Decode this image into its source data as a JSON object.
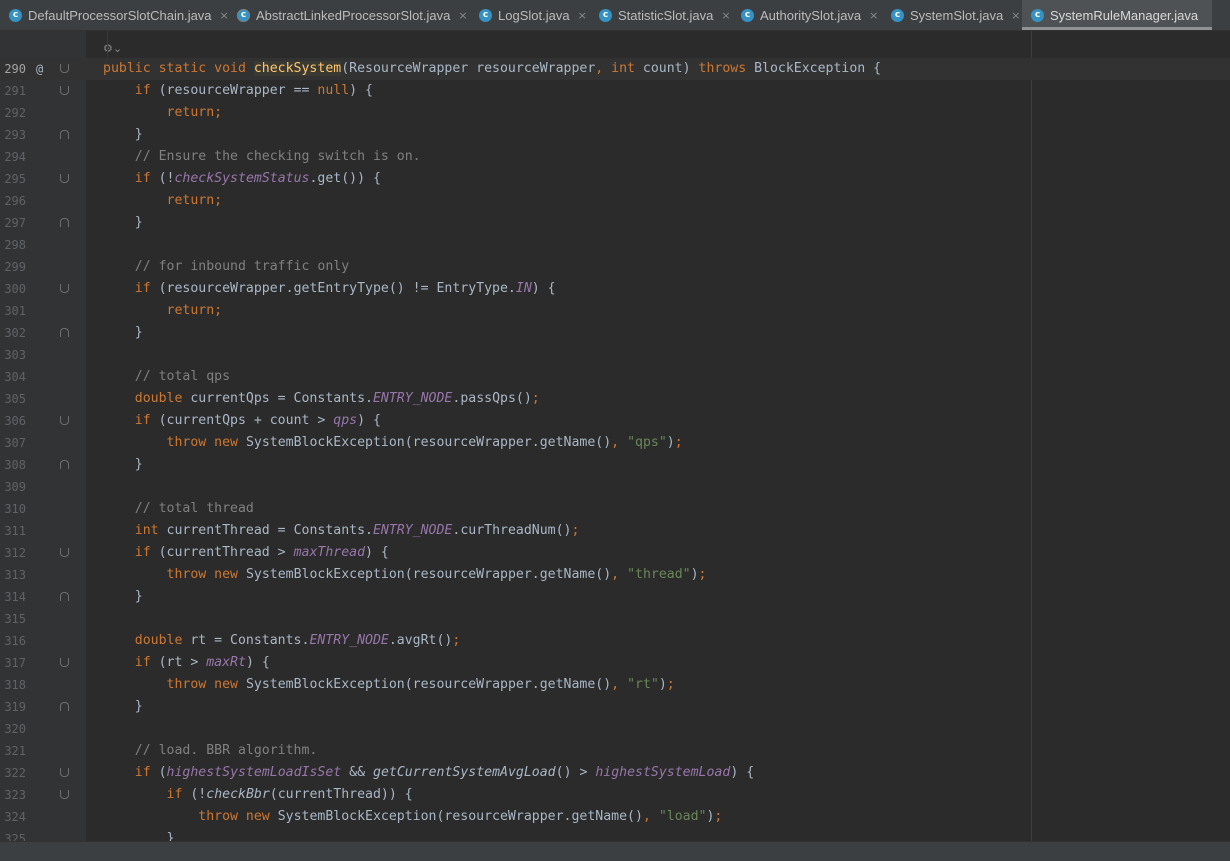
{
  "tabs": [
    {
      "label": "DefaultProcessorSlotChain.java",
      "icon": "class-icon",
      "close": "×"
    },
    {
      "label": "AbstractLinkedProcessorSlot.java",
      "icon": "abstract-class-icon",
      "close": "×"
    },
    {
      "label": "LogSlot.java",
      "icon": "class-icon",
      "close": "×"
    },
    {
      "label": "StatisticSlot.java",
      "icon": "class-icon",
      "close": "×"
    },
    {
      "label": "AuthoritySlot.java",
      "icon": "class-icon",
      "close": "×"
    },
    {
      "label": "SystemSlot.java",
      "icon": "class-icon",
      "close": "×"
    },
    {
      "label": "SystemRuleManager.java",
      "icon": "class-icon",
      "close": ""
    }
  ],
  "tab_icon_letter": "c",
  "editor": {
    "gutter_marker": "@",
    "annotation_icon": "⚙⌄",
    "lines": [
      {
        "n": "290",
        "tokens": [
          [
            "kw",
            "public static void "
          ],
          [
            "fnh",
            "checkSystem"
          ],
          [
            "tx",
            "(ResourceWrapper resourceWrapper"
          ],
          [
            "kw",
            ", int "
          ],
          [
            "tx",
            "count) "
          ],
          [
            "kw",
            "throws "
          ],
          [
            "tx",
            "BlockException {"
          ]
        ]
      },
      {
        "n": "291",
        "tokens": [
          [
            "tx",
            "    "
          ],
          [
            "kw",
            "if "
          ],
          [
            "tx",
            "(resourceWrapper == "
          ],
          [
            "kw",
            "null"
          ],
          [
            "tx",
            ") {"
          ]
        ]
      },
      {
        "n": "292",
        "tokens": [
          [
            "tx",
            "        "
          ],
          [
            "kw",
            "return;"
          ]
        ]
      },
      {
        "n": "293",
        "tokens": [
          [
            "tx",
            "    }"
          ]
        ]
      },
      {
        "n": "294",
        "tokens": [
          [
            "tx",
            "    "
          ],
          [
            "cm",
            "// Ensure the checking switch is on."
          ]
        ]
      },
      {
        "n": "295",
        "tokens": [
          [
            "tx",
            "    "
          ],
          [
            "kw",
            "if "
          ],
          [
            "tx",
            "(!"
          ],
          [
            "sf",
            "checkSystemStatus"
          ],
          [
            "tx",
            ".get()) {"
          ]
        ]
      },
      {
        "n": "296",
        "tokens": [
          [
            "tx",
            "        "
          ],
          [
            "kw",
            "return;"
          ]
        ]
      },
      {
        "n": "297",
        "tokens": [
          [
            "tx",
            "    }"
          ]
        ]
      },
      {
        "n": "298",
        "tokens": []
      },
      {
        "n": "299",
        "tokens": [
          [
            "tx",
            "    "
          ],
          [
            "cm",
            "// for inbound traffic only"
          ]
        ]
      },
      {
        "n": "300",
        "tokens": [
          [
            "tx",
            "    "
          ],
          [
            "kw",
            "if "
          ],
          [
            "tx",
            "(resourceWrapper.getEntryType() != EntryType."
          ],
          [
            "sf",
            "IN"
          ],
          [
            "tx",
            ") {"
          ]
        ]
      },
      {
        "n": "301",
        "tokens": [
          [
            "tx",
            "        "
          ],
          [
            "kw",
            "return;"
          ]
        ]
      },
      {
        "n": "302",
        "tokens": [
          [
            "tx",
            "    }"
          ]
        ]
      },
      {
        "n": "303",
        "tokens": []
      },
      {
        "n": "304",
        "tokens": [
          [
            "tx",
            "    "
          ],
          [
            "cm",
            "// total qps"
          ]
        ]
      },
      {
        "n": "305",
        "tokens": [
          [
            "tx",
            "    "
          ],
          [
            "kw",
            "double "
          ],
          [
            "tx",
            "currentQps = Constants."
          ],
          [
            "sf",
            "ENTRY_NODE"
          ],
          [
            "tx",
            ".passQps()"
          ],
          [
            "kw",
            ";"
          ]
        ]
      },
      {
        "n": "306",
        "tokens": [
          [
            "tx",
            "    "
          ],
          [
            "kw",
            "if "
          ],
          [
            "tx",
            "(currentQps + count > "
          ],
          [
            "sf",
            "qps"
          ],
          [
            "tx",
            ") {"
          ]
        ]
      },
      {
        "n": "307",
        "tokens": [
          [
            "tx",
            "        "
          ],
          [
            "kw",
            "throw new "
          ],
          [
            "tx",
            "SystemBlockException(resourceWrapper.getName()"
          ],
          [
            "kw",
            ", "
          ],
          [
            "st",
            "\"qps\""
          ],
          [
            "tx",
            ")"
          ],
          [
            "kw",
            ";"
          ]
        ]
      },
      {
        "n": "308",
        "tokens": [
          [
            "tx",
            "    }"
          ]
        ]
      },
      {
        "n": "309",
        "tokens": []
      },
      {
        "n": "310",
        "tokens": [
          [
            "tx",
            "    "
          ],
          [
            "cm",
            "// total thread"
          ]
        ]
      },
      {
        "n": "311",
        "tokens": [
          [
            "tx",
            "    "
          ],
          [
            "kw",
            "int "
          ],
          [
            "tx",
            "currentThread = Constants."
          ],
          [
            "sf",
            "ENTRY_NODE"
          ],
          [
            "tx",
            ".curThreadNum()"
          ],
          [
            "kw",
            ";"
          ]
        ]
      },
      {
        "n": "312",
        "tokens": [
          [
            "tx",
            "    "
          ],
          [
            "kw",
            "if "
          ],
          [
            "tx",
            "(currentThread > "
          ],
          [
            "sf",
            "maxThread"
          ],
          [
            "tx",
            ") {"
          ]
        ]
      },
      {
        "n": "313",
        "tokens": [
          [
            "tx",
            "        "
          ],
          [
            "kw",
            "throw new "
          ],
          [
            "tx",
            "SystemBlockException(resourceWrapper.getName()"
          ],
          [
            "kw",
            ", "
          ],
          [
            "st",
            "\"thread\""
          ],
          [
            "tx",
            ")"
          ],
          [
            "kw",
            ";"
          ]
        ]
      },
      {
        "n": "314",
        "tokens": [
          [
            "tx",
            "    }"
          ]
        ]
      },
      {
        "n": "315",
        "tokens": []
      },
      {
        "n": "316",
        "tokens": [
          [
            "tx",
            "    "
          ],
          [
            "kw",
            "double "
          ],
          [
            "tx",
            "rt = Constants."
          ],
          [
            "sf",
            "ENTRY_NODE"
          ],
          [
            "tx",
            ".avgRt()"
          ],
          [
            "kw",
            ";"
          ]
        ]
      },
      {
        "n": "317",
        "tokens": [
          [
            "tx",
            "    "
          ],
          [
            "kw",
            "if "
          ],
          [
            "tx",
            "(rt > "
          ],
          [
            "sf",
            "maxRt"
          ],
          [
            "tx",
            ") {"
          ]
        ]
      },
      {
        "n": "318",
        "tokens": [
          [
            "tx",
            "        "
          ],
          [
            "kw",
            "throw new "
          ],
          [
            "tx",
            "SystemBlockException(resourceWrapper.getName()"
          ],
          [
            "kw",
            ", "
          ],
          [
            "st",
            "\"rt\""
          ],
          [
            "tx",
            ")"
          ],
          [
            "kw",
            ";"
          ]
        ]
      },
      {
        "n": "319",
        "tokens": [
          [
            "tx",
            "    }"
          ]
        ]
      },
      {
        "n": "320",
        "tokens": []
      },
      {
        "n": "321",
        "tokens": [
          [
            "tx",
            "    "
          ],
          [
            "cm",
            "// load. BBR algorithm."
          ]
        ]
      },
      {
        "n": "322",
        "tokens": [
          [
            "tx",
            "    "
          ],
          [
            "kw",
            "if "
          ],
          [
            "tx",
            "("
          ],
          [
            "sf",
            "highestSystemLoadIsSet "
          ],
          [
            "tx",
            "&& "
          ],
          [
            "si",
            "getCurrentSystemAvgLoad"
          ],
          [
            "tx",
            "() > "
          ],
          [
            "sf",
            "highestSystemLoad"
          ],
          [
            "tx",
            ") {"
          ]
        ]
      },
      {
        "n": "323",
        "tokens": [
          [
            "tx",
            "        "
          ],
          [
            "kw",
            "if "
          ],
          [
            "tx",
            "(!"
          ],
          [
            "si",
            "checkBbr"
          ],
          [
            "tx",
            "(currentThread)) {"
          ]
        ]
      },
      {
        "n": "324",
        "tokens": [
          [
            "tx",
            "            "
          ],
          [
            "kw",
            "throw new "
          ],
          [
            "tx",
            "SystemBlockException(resourceWrapper.getName()"
          ],
          [
            "kw",
            ", "
          ],
          [
            "st",
            "\"load\""
          ],
          [
            "tx",
            ")"
          ],
          [
            "kw",
            ";"
          ]
        ]
      },
      {
        "n": "325",
        "tokens": [
          [
            "tx",
            "        }"
          ]
        ]
      }
    ]
  }
}
